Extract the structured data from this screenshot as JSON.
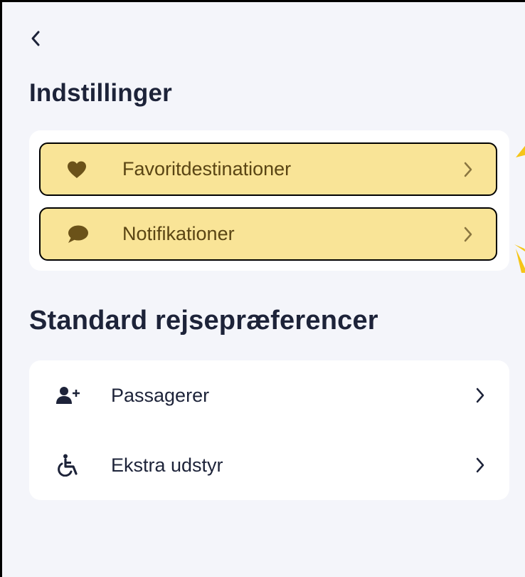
{
  "header": {
    "back_icon": "chevron-left-icon"
  },
  "settings": {
    "title": "Indstillinger",
    "items": [
      {
        "label": "Favoritdestinationer",
        "icon": "heart-icon",
        "highlighted": true
      },
      {
        "label": "Notifikationer",
        "icon": "chat-bubble-icon",
        "highlighted": true
      }
    ]
  },
  "travel": {
    "title": "Standard rejsepræferencer",
    "items": [
      {
        "label": "Passagerer",
        "icon": "add-person-icon"
      },
      {
        "label": "Ekstra udstyr",
        "icon": "wheelchair-icon"
      }
    ]
  },
  "colors": {
    "background": "#f4f5fa",
    "card": "#ffffff",
    "text": "#1d2339",
    "highlight_fill": "#f9e497",
    "highlight_icon": "#6b5219",
    "annotation_arrow": "#f5c518"
  }
}
